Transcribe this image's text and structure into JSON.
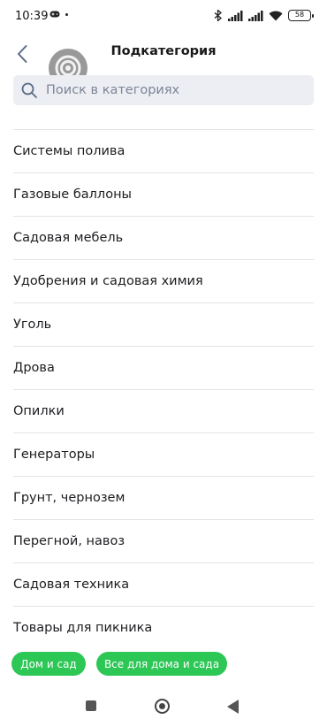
{
  "status_bar": {
    "time": "10:39",
    "battery": "58"
  },
  "header": {
    "title": "Подкатегория"
  },
  "search": {
    "placeholder": "Поиск в категориях"
  },
  "categories": [
    "Системы полива",
    "Газовые баллоны",
    "Садовая мебель",
    "Удобрения и садовая химия",
    "Уголь",
    "Дрова",
    "Опилки",
    "Генераторы",
    "Грунт, чернозем",
    "Перегной, навоз",
    "Садовая техника",
    "Товары для пикника"
  ],
  "breadcrumbs": [
    "Дом и сад",
    "Все для дома и сада"
  ],
  "colors": {
    "accent": "#2dc755",
    "search_bg": "#eceef3",
    "back_icon": "#5b6b86"
  },
  "icons": {
    "back": "chevron-left-icon",
    "search": "search-icon",
    "nav_recents": "square-icon",
    "nav_home": "circle-icon",
    "nav_back": "triangle-back-icon"
  }
}
